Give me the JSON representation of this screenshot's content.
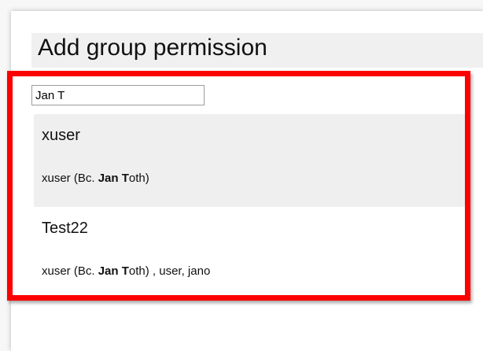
{
  "dialog": {
    "title": "Add group permission"
  },
  "search": {
    "value": "Jan T"
  },
  "results": [
    {
      "name": "xuser",
      "detail_prefix": "xuser (Bc. ",
      "detail_match1": "Jan",
      "detail_mid": " ",
      "detail_match2": "T",
      "detail_suffix": "oth)",
      "selected": true
    },
    {
      "name": "Test22",
      "detail_prefix": "xuser (Bc. ",
      "detail_match1": "Jan",
      "detail_mid": " ",
      "detail_match2": "T",
      "detail_suffix": "oth) , user, jano",
      "selected": false
    }
  ],
  "colors": {
    "highlight": "#ff0000",
    "selected_bg": "#efefef"
  }
}
